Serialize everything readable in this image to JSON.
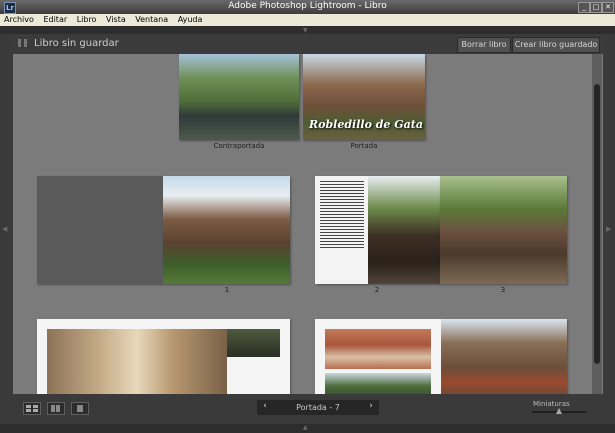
{
  "window": {
    "title": "Adobe Photoshop Lightroom - Libro",
    "icon_text": "Lr",
    "controls": [
      "_",
      "□",
      "✕"
    ]
  },
  "menu": [
    "Archivo",
    "Editar",
    "Libro",
    "Vista",
    "Ventana",
    "Ayuda"
  ],
  "header": {
    "book_title": "Libro sin guardar",
    "clear_label": "Borrar libro",
    "create_label": "Crear libro guardado"
  },
  "spreads": {
    "cover": {
      "back_caption": "Contraportada",
      "front_caption": "Portada",
      "cover_text": "Robledillo de Gata"
    },
    "page1_caption": "1",
    "page2_caption": "2",
    "page3_caption": "3"
  },
  "toolbar": {
    "view_icons": [
      "multi-page-view-icon",
      "spread-view-icon",
      "single-page-view-icon"
    ],
    "prev": "‹",
    "next": "›",
    "pager_label": "Portada - 7",
    "thumbnails_label": "Miniaturas",
    "thumbnail_size": 0.5
  },
  "colors": {
    "canvas": "#7b7b7b",
    "panel": "#3a3a3a"
  }
}
